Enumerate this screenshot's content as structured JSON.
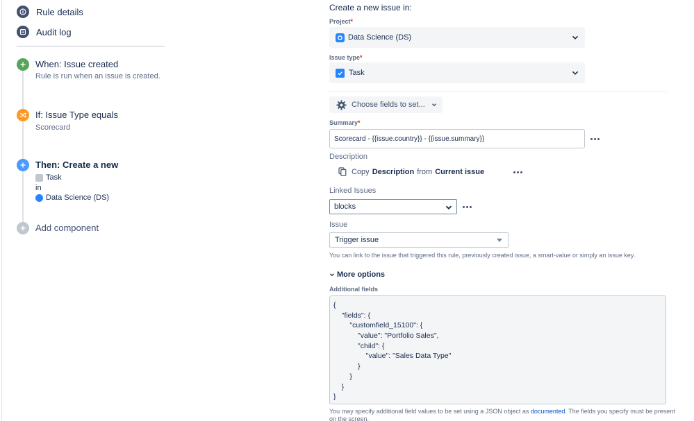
{
  "sidebar": {
    "rule_details_label": "Rule details",
    "audit_log_label": "Audit log",
    "trigger": {
      "title": "When: Issue created",
      "subtitle": "Rule is run when an issue is created.",
      "color": "#57a55a"
    },
    "condition": {
      "title": "If: Issue Type equals",
      "subtitle": "Scorecard",
      "color": "#ff991f"
    },
    "action": {
      "title": "Then: Create a new",
      "issue_type": "Task",
      "in_label": "in",
      "project": "Data Science (DS)",
      "color": "#4c9aff"
    },
    "add_component_label": "Add component"
  },
  "form": {
    "heading": "Create a new issue in:",
    "project": {
      "label": "Project",
      "required_mark": "*",
      "value": "Data Science (DS)"
    },
    "issue_type": {
      "label": "Issue type",
      "required_mark": "*",
      "value": "Task"
    },
    "choose_fields_label": "Choose fields to set...",
    "summary": {
      "label": "Summary",
      "required_mark": "*",
      "value": "Scorecard - {{issue.country}} -  {{issue.summary}}"
    },
    "description": {
      "label": "Description",
      "copy_prefix": "Copy",
      "field": "Description",
      "from": "from",
      "source": "Current issue"
    },
    "linked_issues": {
      "label": "Linked Issues",
      "value": "blocks"
    },
    "issue": {
      "label": "Issue",
      "value": "Trigger issue",
      "helper": "You can link to the issue that triggered this rule, previously created issue, a smart-value or simply an issue key."
    },
    "more_options_label": "More options",
    "additional_fields": {
      "label": "Additional fields",
      "json_lines": [
        "{",
        "    \"fields\": {",
        "        \"customfield_15100\": {",
        "            \"value\": \"Portfolio Sales\",",
        "            \"child\": {",
        "                \"value\": \"Sales Data Type\"",
        "            }",
        "        }",
        "    }",
        "}"
      ],
      "helper_prefix": "You may specify additional field values to be set using a JSON object as ",
      "helper_link": "documented",
      "helper_suffix": ". The fields you specify must be present",
      "helper_line2": "on the screen."
    }
  }
}
